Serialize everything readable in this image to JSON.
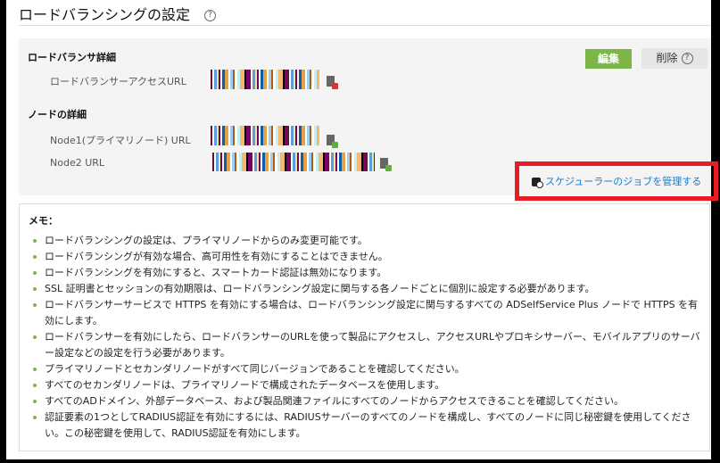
{
  "header": {
    "title": "ロードバランシングの設定",
    "help_icon": "?"
  },
  "load_balancer": {
    "section_title": "ロードバランサ詳細",
    "access_url_label": "ロードバランサーアクセスURL",
    "edit_button": "編集",
    "delete_button": "削除",
    "delete_help_icon": "?"
  },
  "nodes": {
    "section_title": "ノードの詳細",
    "node1_label": "Node1(プライマリノード) URL",
    "node2_label": "Node2 URL"
  },
  "scheduler_link": "スケジューラーのジョブを管理する",
  "memo": {
    "title": "メモ：",
    "items": [
      "ロードバランシングの設定は、プライマリノードからのみ変更可能です。",
      "ロードバランシングが有効な場合、高可用性を有効にすることはできません。",
      "ロードバランシングを有効にすると、スマートカード認証は無効になります。",
      "SSL 証明書とセッションの有効期限は、ロードバランシング設定に関与する各ノードごとに個別に設定する必要があります。",
      "ロードバランサーサービスで HTTPS を有効にする場合は、ロードバランシング設定に関与するすべての ADSelfService Plus ノードで HTTPS を有効にします。",
      "ロードバランサーを有効にしたら、ロードバランサーのURLを使って製品にアクセスし、アクセスURLやプロキシサーバー、モバイルアプリのサーバー設定などの設定を行う必要があります。",
      "プライマリノードとセカンダリノードがすべて同じバージョンであることを確認してください。",
      "すべてのセカンダリノードは、プライマリノードで構成されたデータベースを使用します。",
      "すべてのADドメイン、外部データベース、および製品関連ファイルにすべてのノードからアクセスできることを確認してください。",
      "認証要素の1つとしてRADIUS認証を有効にするには、RADIUSサーバーのすべてのノードを構成し、すべてのノードに同じ秘密鍵を使用してください。この秘密鍵を使用して、RADIUS認証を有効にします。"
    ]
  }
}
